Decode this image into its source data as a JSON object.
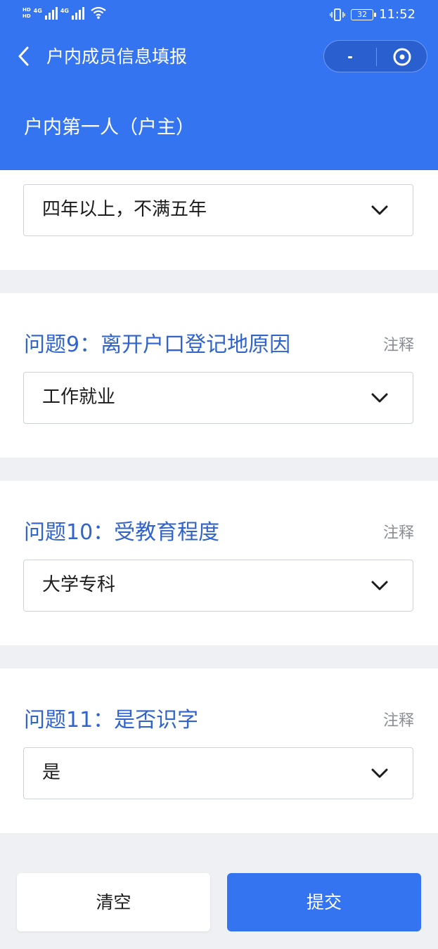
{
  "status_bar": {
    "sim1": "HD",
    "sim2": "HD",
    "network1": "4G",
    "network2": "4G",
    "battery": "32",
    "time": "11:52"
  },
  "nav": {
    "title": "户内成员信息填报"
  },
  "section": {
    "title": "户内第一人（户主）"
  },
  "questions": [
    {
      "title": "",
      "note": "",
      "value": "四年以上，不满五年"
    },
    {
      "title": "问题9：离开户口登记地原因",
      "note": "注释",
      "value": "工作就业"
    },
    {
      "title": "问题10：受教育程度",
      "note": "注释",
      "value": "大学专科"
    },
    {
      "title": "问题11：是否识字",
      "note": "注释",
      "value": "是"
    }
  ],
  "actions": {
    "clear_label": "清空",
    "submit_label": "提交"
  },
  "colors": {
    "primary": "#3574f0",
    "question_title": "#3064cc",
    "background": "#eef0f4"
  },
  "icons": [
    "back-icon",
    "more-icon",
    "close-icon",
    "chevron-down-icon",
    "vibrate-icon",
    "wifi-icon",
    "battery-icon",
    "signal-icon"
  ]
}
